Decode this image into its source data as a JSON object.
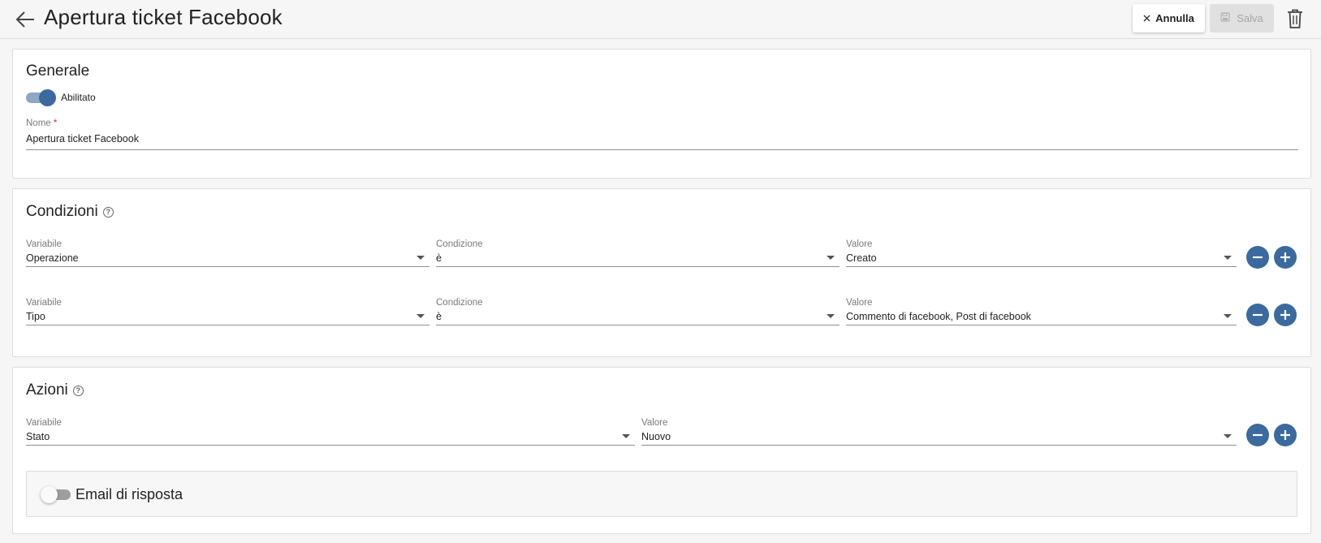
{
  "header": {
    "title": "Apertura ticket Facebook",
    "cancel_label": "Annulla",
    "save_label": "Salva"
  },
  "generale": {
    "title": "Generale",
    "enabled_label": "Abilitato",
    "enabled": true,
    "name_label": "Nome",
    "required_mark": "*",
    "name_value": "Apertura ticket Facebook"
  },
  "condizioni": {
    "title": "Condizioni",
    "rows": [
      {
        "variabile_label": "Variabile",
        "variabile": "Operazione",
        "condizione_label": "Condizione",
        "condizione": "è",
        "valore_label": "Valore",
        "valore": "Creato"
      },
      {
        "variabile_label": "Variabile",
        "variabile": "Tipo",
        "condizione_label": "Condizione",
        "condizione": "è",
        "valore_label": "Valore",
        "valore": "Commento di facebook, Post di facebook"
      }
    ]
  },
  "azioni": {
    "title": "Azioni",
    "rows": [
      {
        "variabile_label": "Variabile",
        "variabile": "Stato",
        "valore_label": "Valore",
        "valore": "Nuovo"
      }
    ],
    "email_label": "Email di risposta",
    "email_enabled": false
  },
  "colors": {
    "accent": "#3a6a9e",
    "toggle_track_on": "#8ea7c2",
    "required": "#d32f2f"
  },
  "icons": {
    "back": "arrow-left-icon",
    "cancel": "close-icon",
    "save": "floppy-disk-icon",
    "delete": "trash-icon",
    "help": "help-circle-icon",
    "remove": "minus-icon",
    "add": "plus-icon",
    "dropdown": "caret-down-icon"
  }
}
